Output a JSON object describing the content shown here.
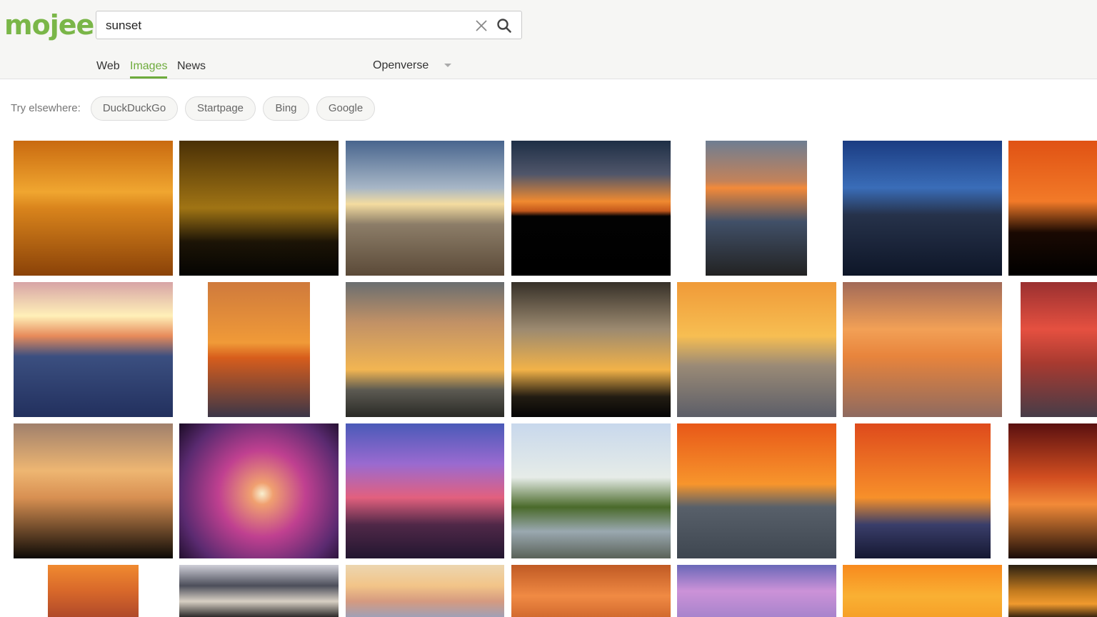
{
  "header": {
    "logo": "mojeek",
    "search": {
      "value": "sunset",
      "placeholder": ""
    },
    "tabs": [
      {
        "label": "Web"
      },
      {
        "label": "Images",
        "active": true
      },
      {
        "label": "News"
      }
    ],
    "source": {
      "selected": "Openverse"
    }
  },
  "elsewhere": {
    "label": "Try elsewhere:",
    "engines": [
      "DuckDuckGo",
      "Startpage",
      "Bing",
      "Google"
    ]
  },
  "icons": {
    "clear": "close-icon",
    "search": "search-icon",
    "source": "chevron-down-icon"
  },
  "colors": {
    "brand": "#7ab648",
    "active_tab": "#6eab3c",
    "header_bg": "#f6f6f4"
  },
  "images": [
    {
      "bg": "linear-gradient(180deg,#c96a10 0%,#f0a630 38%,#d9841c 50%,#8a4208 100%)"
    },
    {
      "bg": "linear-gradient(180deg,#4a3006 0%,#a07414 50%,#1c1406 75%,#050402 100%)"
    },
    {
      "bg": "linear-gradient(180deg,#48658e 0%,#a7b6c6 35%,#f4dca0 47%,#8c7d68 62%,#5b4a38 100%)"
    },
    {
      "bg": "linear-gradient(180deg,#1e2f46 0%,#50566a 25%,#f08a30 45%,#c4581c 52%,#020202 56%,#000000 100%)"
    },
    {
      "bg": "linear-gradient(180deg,#6e7e92 0%,#c3825a 30%,#f38a3a 35%,#415068 60%,#222222 100%)"
    },
    {
      "bg": "linear-gradient(180deg,#1b3c82 0%,#3a6db8 35%,#26324a 55%,#0e1628 100%)"
    },
    {
      "bg": "linear-gradient(180deg,#e05214 0%,#f27a28 45%,#1a0902 68%,#000000 100%)"
    },
    {
      "bg": "linear-gradient(180deg,#d7a4a6 0%,#fff0b8 25%,#e78a5a 40%,#3b4f80 55%,#22305e 100%)"
    },
    {
      "bg": "linear-gradient(180deg,#cf7a3c 0%,#f09a38 45%,#d75d1c 56%,#3b3648 100%)"
    },
    {
      "bg": "linear-gradient(180deg,#6a6e70 0%,#c19166 30%,#f2b552 65%,#5c5a52 80%,#2a2a26 100%)"
    },
    {
      "bg": "linear-gradient(180deg,#363028 0%,#9c8a70 35%,#f2b248 65%,#221c12 85%,#050505 100%)"
    },
    {
      "bg": "linear-gradient(180deg,#f09a38 0%,#f7be52 40%,#9a8a76 62%,#5c5e68 100%)"
    },
    {
      "bg": "linear-gradient(180deg,#a26a58 0%,#f2a056 35%,#e8843c 55%,#8e6a60 100%)"
    },
    {
      "bg": "linear-gradient(180deg,#9a3030 0%,#e55040 35%,#a83a30 60%,#463c48 100%)"
    },
    {
      "bg": "linear-gradient(180deg,#a0806c 0%,#eeb672 35%,#d89052 55%,#0c0906 100%)"
    },
    {
      "bg": "radial-gradient(circle at 52% 52%,#f8f0d0 0%,#f0a070 10%,#c04090 40%,#5a2a70 75%,#1c0c26 100%)"
    },
    {
      "bg": "linear-gradient(180deg,#4a5ab8 0%,#9a6ad0 30%,#e2607e 55%,#502848 75%,#221630 100%)"
    },
    {
      "bg": "linear-gradient(180deg,#c8d8ec 0%,#e6ece8 40%,#4a6a2a 62%,#9aa8b0 80%,#5a6258 100%)"
    },
    {
      "bg": "linear-gradient(180deg,#e85818 0%,#f7952c 45%,#58606a 62%,#3e4650 100%)"
    },
    {
      "bg": "linear-gradient(180deg,#de4a1c 0%,#f7902a 55%,#3a3e6a 75%,#151832 100%)"
    },
    {
      "bg": "linear-gradient(180deg,#5a1010 0%,#d24e20 40%,#f28a38 60%,#1a0c08 100%)"
    },
    {
      "bg": "linear-gradient(180deg,#f08a30 0%,#d8682a 50%,#b04a2a 100%)"
    },
    {
      "bg": "linear-gradient(180deg,#cfcfd8 0%,#4c4e5a 40%,#d8d0c4 70%,#2c2a2a 100%)"
    },
    {
      "bg": "linear-gradient(180deg,#ecd6b0 0%,#f2c488 40%,#d59a80 70%,#a0a0b6 100%)"
    },
    {
      "bg": "linear-gradient(180deg,#c05a24 0%,#f08a44 60%,#d26a2e 100%)"
    },
    {
      "bg": "linear-gradient(180deg,#6a68b8 0%,#cc92d8 50%,#a884cc 100%)"
    },
    {
      "bg": "linear-gradient(180deg,#f88a1e 0%,#f9b033 60%,#f6a028 100%)"
    },
    {
      "bg": "linear-gradient(180deg,#2a2012 0%,#c27a1e 50%,#f09a2e 75%,#3a2510 100%)"
    }
  ]
}
